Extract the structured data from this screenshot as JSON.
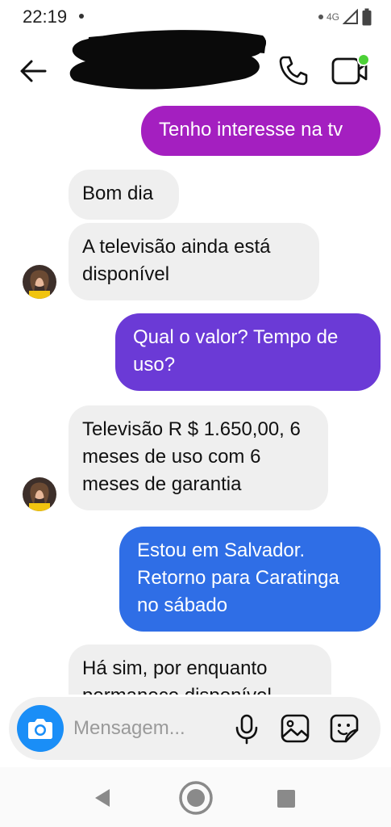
{
  "status_bar": {
    "time": "22:19",
    "network": "4G"
  },
  "header": {
    "contact_name": ""
  },
  "messages": [
    {
      "direction": "outgoing",
      "text": "Tenho interesse na tv"
    },
    {
      "direction": "incoming",
      "text": "Bom dia"
    },
    {
      "direction": "incoming",
      "text": "A televisão ainda está disponível"
    },
    {
      "direction": "outgoing",
      "text": "Qual o valor? Tempo de uso?"
    },
    {
      "direction": "incoming",
      "text": "Televisão R $ 1.650,00, 6 meses de uso com 6 meses de garantia"
    },
    {
      "direction": "outgoing",
      "text": "Estou em Salvador. Retorno para Caratinga no sábado"
    },
    {
      "direction": "incoming",
      "text": "Há sim, por enquanto permanece disponível"
    }
  ],
  "composer": {
    "placeholder": "Mensagem..."
  },
  "colors": {
    "gradient_top": "#a41fc0",
    "gradient_mid": "#6b3ad6",
    "gradient_bottom": "#2f6ee6",
    "incoming_bubble": "#efefef",
    "camera_button": "#1a8ef7",
    "presence_dot": "#4cd137"
  },
  "icons": [
    "back-arrow-icon",
    "phone-icon",
    "video-call-icon",
    "camera-icon",
    "microphone-icon",
    "gallery-icon",
    "sticker-icon",
    "nav-back-icon",
    "nav-home-icon",
    "nav-recents-icon"
  ]
}
